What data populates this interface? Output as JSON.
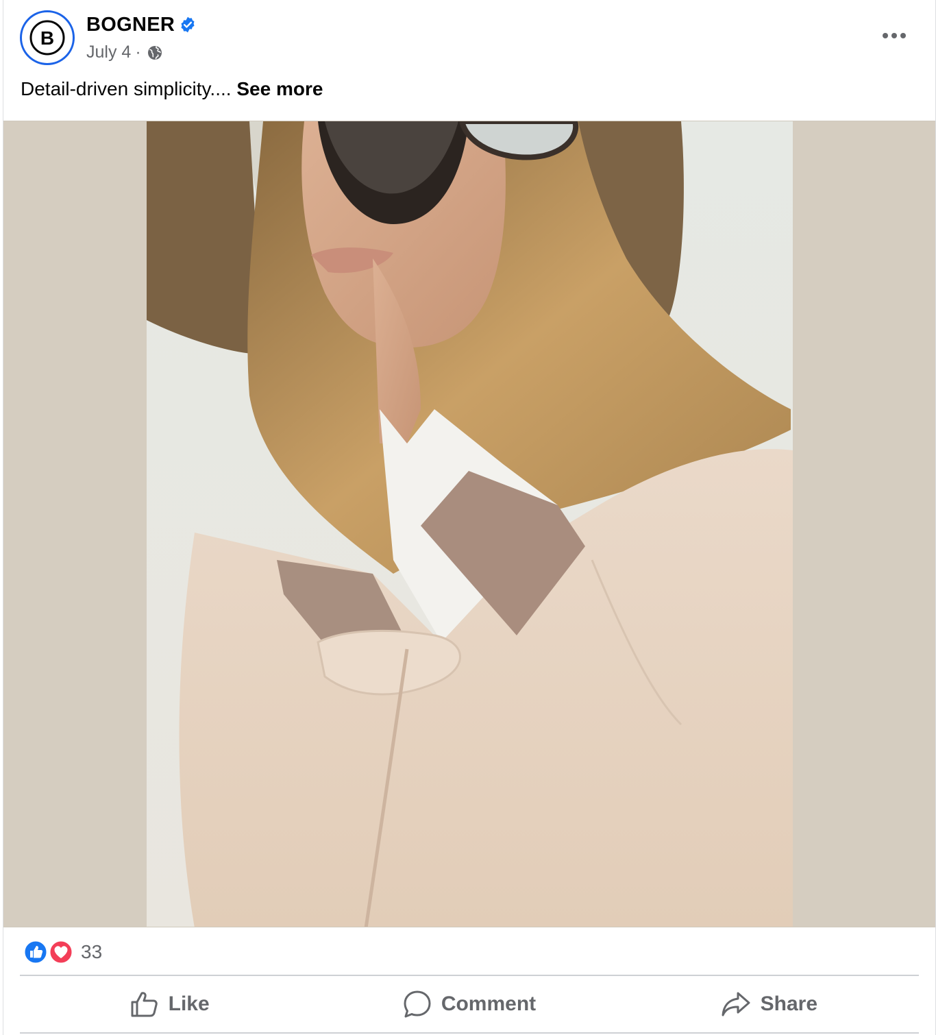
{
  "post": {
    "author": "BOGNER",
    "avatar_letter": "B",
    "verified_icon": "verified-badge-icon",
    "date": "July 4",
    "separator": "·",
    "audience_icon": "globe-icon",
    "more_icon": "more-options-icon",
    "caption": "Detail-driven simplicity....",
    "see_more": "See more"
  },
  "reactions": {
    "icons": [
      "like-reaction-icon",
      "love-reaction-icon"
    ],
    "count": "33"
  },
  "actions": {
    "like_label": "Like",
    "comment_label": "Comment",
    "share_label": "Share"
  },
  "colors": {
    "brand_blue": "#1b63e8",
    "verified_blue": "#1877f2",
    "love_red": "#f33e58",
    "media_background": "#d5cdc0",
    "secondary_text": "#65676b"
  }
}
